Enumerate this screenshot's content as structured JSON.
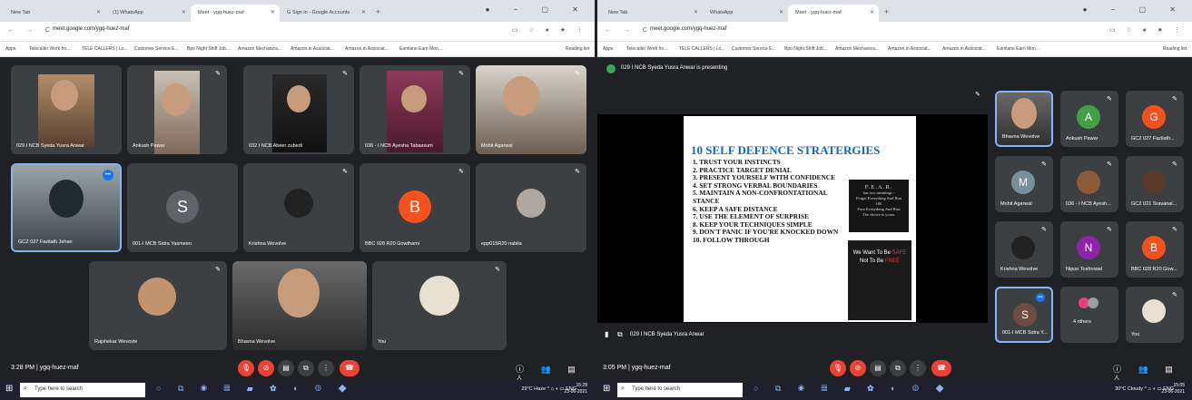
{
  "left": {
    "tabs": [
      {
        "label": "New Tab"
      },
      {
        "label": "(1) WhatsApp"
      },
      {
        "label": "Meet - ygq-huez-maf"
      },
      {
        "label": "G Sign in - Google Accounts"
      }
    ],
    "url": "meet.google.com/ygq-huez-maf",
    "bookmarks": [
      "Apps",
      "Telecaller Work fro...",
      "TELE CALLERS | Lo...",
      "Customer Service E...",
      "Bpo Night Shift Job...",
      "Amazon Mechanica...",
      "Amazon.in Associat...",
      "Amazon.in Associat...",
      "Eamlane Earn Mon..."
    ],
    "reading_list": "Reading list",
    "tiles": [
      {
        "name": "029 I NCB Syeda Yusra Anwar"
      },
      {
        "name": "Ankush Pawar"
      },
      {
        "name": "032 I NCB Abeer zubedi"
      },
      {
        "name": "036 - I NCB Ayesha Tabassum"
      },
      {
        "name": "Mohit Agarwal"
      },
      {
        "name": "GCZ 027 Fazilath Jehan"
      },
      {
        "name": "001-I MCB Sidra Yasmeen",
        "initial": "S"
      },
      {
        "name": "Krishna Wevolve"
      },
      {
        "name": "BBC 028 R20 Gowthami",
        "initial": "B"
      },
      {
        "name": "epp015R20 nabila"
      },
      {
        "name": "Rajshekar Wevovle"
      },
      {
        "name": "Bhavna Wevolve"
      },
      {
        "name": "You"
      }
    ],
    "time_meeting": "3:28 PM  |  ygq-huez-maf",
    "taskbar": {
      "search_placeholder": "Type here to search",
      "weather": "29°C Haze",
      "lang": "ENG",
      "time": "15:28",
      "date": "23-06-2021"
    }
  },
  "right": {
    "tabs": [
      {
        "label": "New Tab"
      },
      {
        "label": "WhatsApp"
      },
      {
        "label": "Meet - ygq-huez-maf"
      }
    ],
    "url": "meet.google.com/ygq-huez-maf",
    "bookmarks": [
      "Apps",
      "Telecaller Work fro...",
      "TELE CALLERS | Lo...",
      "Customer Service E...",
      "Bpo Night Shift Job...",
      "Amazon Mechanica...",
      "Amazon.in Associat...",
      "Amazon.in Associat...",
      "Eamlane Earn Mon..."
    ],
    "reading_list": "Reading list",
    "presenting_banner": "029 I NCB Syeda Yusra Anwar is presenting",
    "slide": {
      "title": "10 SELF DEFENCE STRATERGIES",
      "items": [
        "1. TRUST YOUR INSTINCTS",
        "2. PRACTICE TARGET DENIAL",
        "3. PRESENT YOURSELF WITH CONFIDENCE",
        "4. SET STRONG VERBAL BOUNDARIES",
        "5. MAINTAIN A NON-CONFRONTATIONAL STANCE",
        "6. KEEP A SAFE DISTANCE",
        "7. USE THE ELEMENT OF SURPRISE",
        "8. KEEP YOUR TECHNIQUES SIMPLE",
        "9. DON'T PANIC IF YOU'RE KNOCKED DOWN",
        "10. FOLLOW THROUGH"
      ],
      "fear": {
        "title": "F.E.A.R.",
        "sub": "has two meanings -",
        "line1": "Forget Everything And Run",
        "or": "OR",
        "line2": "Face Everything And Rise",
        "choice": "The choice is yours."
      },
      "want": {
        "a": "We Want To Be",
        "b": "SAFE",
        "c": "Not To Be",
        "d": "FREE"
      }
    },
    "presenter_label": "029 I NCB Syeda Yusra Anwar",
    "side_tiles": [
      {
        "name": "Bhavna Wevolve"
      },
      {
        "name": "Ankush Pawar",
        "initial": "A",
        "color": "#43a047"
      },
      {
        "name": "GCZ 027 Fazilath...",
        "initial": "G",
        "color": "#f4511e"
      },
      {
        "name": "Mohit Agarwal",
        "initial": "M",
        "color": "#78909c"
      },
      {
        "name": "036 - I NCB Ayesh..."
      },
      {
        "name": "GCZ 021 Sravanal..."
      },
      {
        "name": "Krishna Wevolve"
      },
      {
        "name": "Nipun Toshniwal",
        "initial": "N",
        "color": "#8e24aa"
      },
      {
        "name": "BBC 028 R20 Gow...",
        "initial": "B",
        "color": "#f4511e"
      },
      {
        "name": "001-I MCB Sidra Y...",
        "initial": "S",
        "color": "#6d4c41"
      },
      {
        "name": "4 others"
      },
      {
        "name": "You"
      }
    ],
    "time_meeting": "3:05 PM  |  ygq-huez-maf",
    "taskbar": {
      "search_placeholder": "Type here to search",
      "weather": "30°C Cloudy",
      "lang": "ENG",
      "time": "15:05",
      "date": "23-06-2021"
    }
  },
  "colors": {
    "end_call": "#ea4335",
    "meet_bg": "#202124",
    "tile_bg": "#3c4043",
    "accent_blue": "#1a73e8"
  }
}
